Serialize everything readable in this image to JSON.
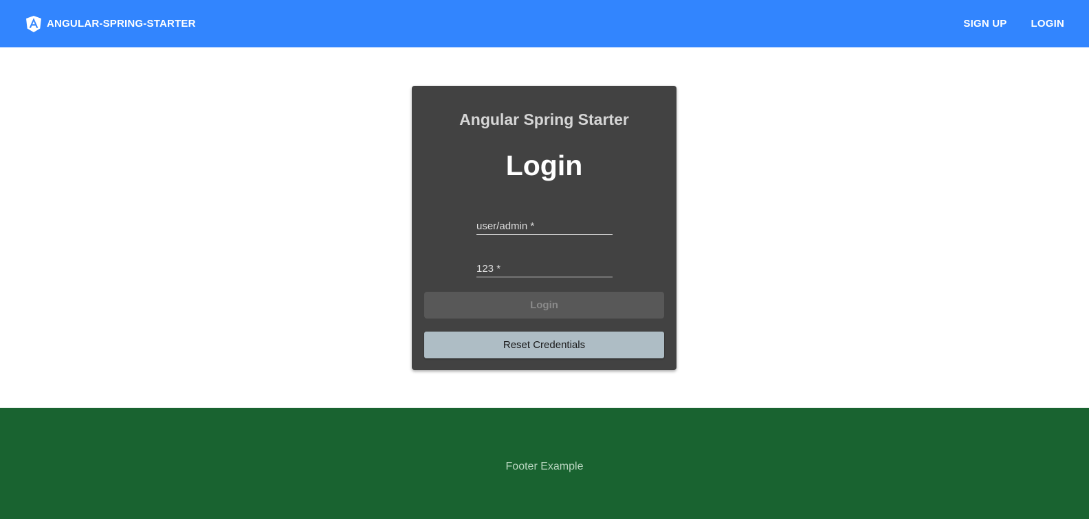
{
  "header": {
    "brand_label": "ANGULAR-SPRING-STARTER",
    "brand_icon": "angular-logo-icon",
    "nav": {
      "signup_label": "SIGN UP",
      "login_label": "LOGIN"
    },
    "bg_color": "#3285fe"
  },
  "card": {
    "subtitle": "Angular Spring Starter",
    "title": "Login",
    "username": {
      "placeholder": "user/admin *",
      "value": ""
    },
    "password": {
      "placeholder": "123 *",
      "value": ""
    },
    "login_button_label": "Login",
    "reset_button_label": "Reset Credentials",
    "bg_color": "#424242"
  },
  "footer": {
    "text": "Footer Example",
    "bg_color": "#196330"
  }
}
